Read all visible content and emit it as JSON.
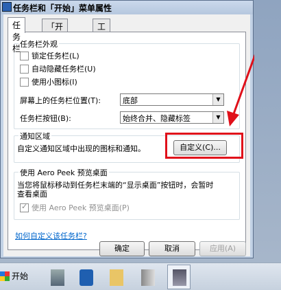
{
  "window": {
    "title": "任务栏和「开始」菜单属性"
  },
  "tabs": [
    {
      "label": "任务栏"
    },
    {
      "label": "「开始」菜单"
    },
    {
      "label": "工具栏"
    }
  ],
  "appearance": {
    "group_label": "任务栏外观",
    "lock_label": "锁定任务栏(L)",
    "autohide_label": "自动隐藏任务栏(U)",
    "small_icons_label": "使用小图标(I)",
    "location_label": "屏幕上的任务栏位置(T):",
    "location_value": "底部",
    "buttons_label": "任务栏按钮(B):",
    "buttons_value": "始终合并、隐藏标签"
  },
  "notification": {
    "group_label": "通知区域",
    "description": "自定义通知区域中出现的图标和通知。",
    "customize_button": "自定义(C)..."
  },
  "aero_peek": {
    "group_label": "使用 Aero Peek 预览桌面",
    "description_line1": "当您将鼠标移动到任务栏末端的“显示桌面”按钮时，会暂时",
    "description_line2": "查看桌面",
    "checkbox_label": "使用 Aero Peek 预览桌面(P)"
  },
  "help_link": "如何自定义该任务栏?",
  "footer": {
    "ok": "确定",
    "cancel": "取消",
    "apply": "应用(A)"
  },
  "taskbar": {
    "start_label": "开始"
  },
  "colors": {
    "highlight": "#e0101a",
    "link": "#0066cc"
  }
}
